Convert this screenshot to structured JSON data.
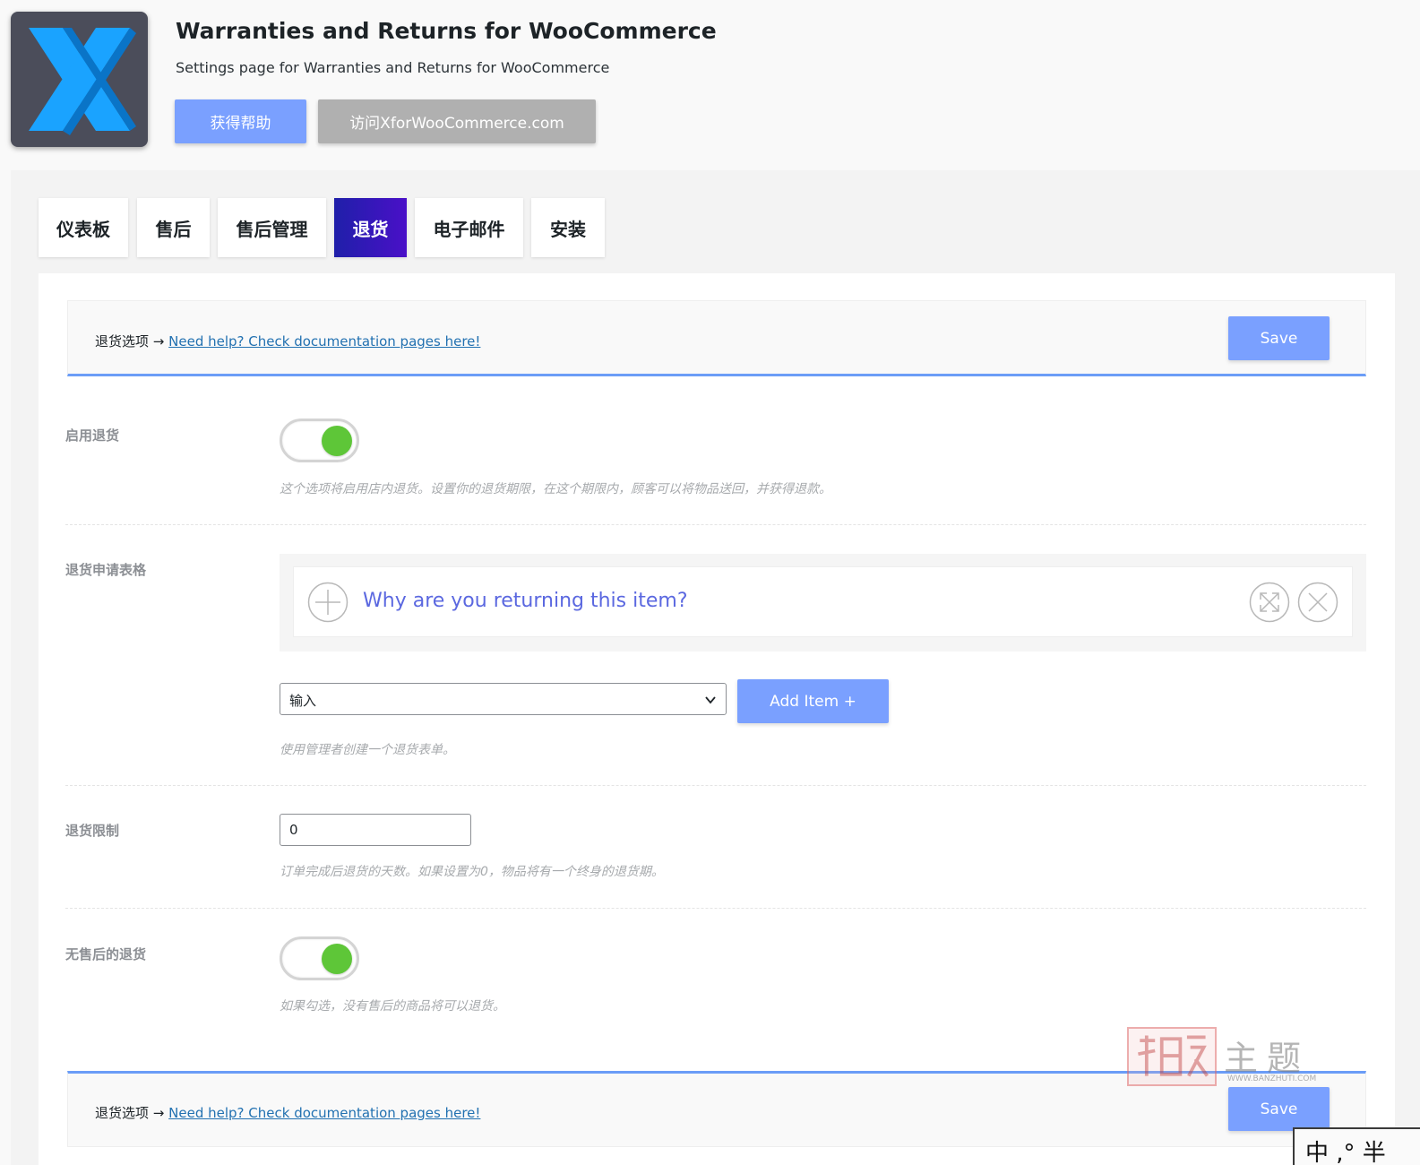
{
  "header": {
    "title": "Warranties and Returns for WooCommerce",
    "subtitle": "Settings page for Warranties and Returns for WooCommerce",
    "help_button": "获得帮助",
    "visit_button": "访问XforWooCommerce.com",
    "logo_icon": "x-logo-icon"
  },
  "tabs": [
    {
      "label": "仪表板",
      "active": false
    },
    {
      "label": "售后",
      "active": false
    },
    {
      "label": "售后管理",
      "active": false
    },
    {
      "label": "退货",
      "active": true
    },
    {
      "label": "电子邮件",
      "active": false
    },
    {
      "label": "安装",
      "active": false
    }
  ],
  "options_bar": {
    "label": "退货选项",
    "arrow": "→",
    "doc_link": "Need help? Check documentation pages here!",
    "save_label": "Save"
  },
  "settings": {
    "enable_returns": {
      "label": "启用退货",
      "enabled": true,
      "description": "这个选项将启用店内退货。设置你的退货期限，在这个期限内，顾客可以将物品送回，并获得退款。"
    },
    "return_form": {
      "label": "退货申请表格",
      "items": [
        {
          "label": "Why are you returning this item?"
        }
      ],
      "select_value": "输入",
      "add_item_label": "Add Item +",
      "description": "使用管理者创建一个退货表单。"
    },
    "return_limit": {
      "label": "退货限制",
      "value": "0",
      "description": "订单完成后退货的天数。如果设置为0，物品将有一个终身的退货期。"
    },
    "returns_without_warranty": {
      "label": "无售后的退货",
      "enabled": true,
      "description": "如果勾选，没有售后的商品将可以退货。"
    }
  },
  "colors": {
    "accent": "#7aa0ff",
    "active_tab_start": "#1f1fa9",
    "active_tab_end": "#4a10c8",
    "toggle_on": "#5ec638",
    "form_item_text": "#5b68e0"
  },
  "watermark": {
    "text": "主题",
    "url": "WWW.BANZHUTI.COM"
  },
  "ime_bar": {
    "text": "中 ,° 半"
  }
}
